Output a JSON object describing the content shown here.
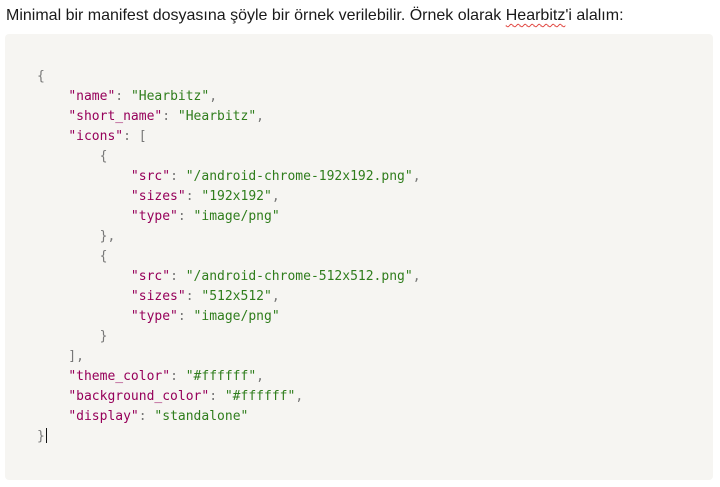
{
  "intro": {
    "before": "Minimal bir manifest dosyasına şöyle bir örnek verilebilir. Örnek olarak ",
    "highlight": "Hearbitz",
    "after": "'i alalım:"
  },
  "code": {
    "open_brace": "{",
    "close_brace": "}",
    "name_key": "\"name\"",
    "name_val": "\"Hearbitz\"",
    "short_name_key": "\"short_name\"",
    "short_name_val": "\"Hearbitz\"",
    "icons_key": "\"icons\"",
    "icons": [
      {
        "src_key": "\"src\"",
        "src_val": "\"/android-chrome-192x192.png\"",
        "sizes_key": "\"sizes\"",
        "sizes_val": "\"192x192\"",
        "type_key": "\"type\"",
        "type_val": "\"image/png\""
      },
      {
        "src_key": "\"src\"",
        "src_val": "\"/android-chrome-512x512.png\"",
        "sizes_key": "\"sizes\"",
        "sizes_val": "\"512x512\"",
        "type_key": "\"type\"",
        "type_val": "\"image/png\""
      }
    ],
    "theme_color_key": "\"theme_color\"",
    "theme_color_val": "\"#ffffff\"",
    "background_color_key": "\"background_color\"",
    "background_color_val": "\"#ffffff\"",
    "display_key": "\"display\"",
    "display_val": "\"standalone\""
  },
  "colors": {
    "key": "#96005a",
    "string": "#2f7d1c",
    "punctuation": "#777777",
    "code_background": "#f6f5f2"
  }
}
